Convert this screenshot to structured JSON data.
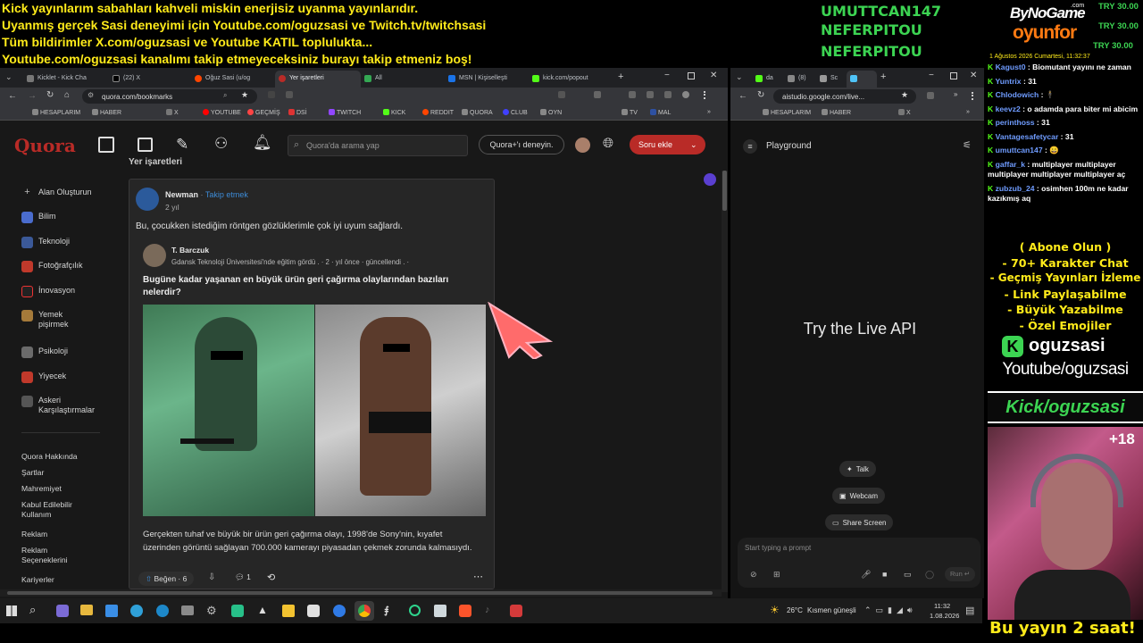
{
  "overlay": {
    "top_lines": [
      "Kick yayınlarım sabahları kahveli miskin enerjisiz uyanma yayınlarıdır.",
      "Uyanmış gerçek Sasi deneyimi için Youtube.com/oguzsasi ve Twitch.tv/twitchsasi",
      "Tüm bildirimler X.com/oguzsasi ve Youtube KATIL toplulukta...",
      "Youtube.com/oguzsasi kanalımı takip etmeyeceksiniz burayı takip etmeniz boş!"
    ],
    "subs": [
      "UMUTTCAN147",
      "NEFERPITOU",
      "NEFERPITOU"
    ],
    "logo_top": "ByNoGame",
    "logo_com": ".com",
    "logo_bottom": "oyunfor",
    "try": [
      "TRY 30.00",
      "TRY 30.00",
      "TRY 30.00"
    ],
    "chat_date": "1 Ağustos 2026 Cumartesi, 11:32:37",
    "chat": [
      {
        "user": "Kagust0",
        "msg": " : Biomutant yayını ne zaman"
      },
      {
        "user": "Yuntrix",
        "msg": " : 31"
      },
      {
        "user": "Chlodowich",
        "msg": " : 🕴"
      },
      {
        "user": "keevz2",
        "msg": " : o adamda para biter mi abicim"
      },
      {
        "user": "perinthoss",
        "msg": " : 31"
      },
      {
        "user": "Vantagesafetycar",
        "msg": " : 31"
      },
      {
        "user": "umuttcan147",
        "msg": " : 😀"
      },
      {
        "user": "gaffar_k",
        "msg": " : multiplayer multiplayer multiplayer multiplayer multiplayer aç"
      },
      {
        "user": "zubzub_24",
        "msg": " : osimhen 100m ne kadar kazıkmış aq"
      }
    ],
    "promo": [
      "( Abone Olun )",
      "- 70+ Karakter Chat",
      "- Geçmiş Yayınları İzleme",
      "- Link Paylaşabilme",
      "- Büyük Yazabilme",
      "- Özel Emojiler"
    ],
    "kick_name": "oguzsasi",
    "youtube_handle": "Youtube/oguzsasi",
    "kick_handle": "Kick/oguzsasi",
    "age": "+18",
    "bottom": "Bu yayın 2 saat!"
  },
  "left_browser": {
    "tabs": [
      "Kicklet - Kick Cha",
      "(22) X",
      "Oğuz Sasi (u/og",
      "Yer işaretleri",
      "All",
      "MSN | Kişiselleşti",
      "kick.com/popout"
    ],
    "url": "quora.com/bookmarks",
    "bookmarks": [
      "HESAPLARIM",
      "HABER",
      "X",
      "YOUTUBE",
      "GEÇMİŞ",
      "DSİ",
      "TWITCH",
      "KICK",
      "REDDIT",
      "QUORA",
      "CLUB",
      "OYN",
      "TV",
      "MAL"
    ]
  },
  "quora": {
    "logo": "Quora",
    "search_placeholder": "Quora'da arama yap",
    "plus_button": "Quora+'ı deneyin.",
    "ask_button": "Soru ekle",
    "section_title": "Yer işaretleri",
    "nav": [
      "Alan Oluşturun",
      "Bilim",
      "Teknoloji",
      "Fotoğrafçılık",
      "İnovasyon",
      "Yemek pişirmek",
      "Psikoloji",
      "Yiyecek",
      "Askeri Karşılaştırmalar"
    ],
    "footer": [
      "Quora Hakkında",
      "Şartlar",
      "Mahremiyet",
      "Kabul Edilebilir Kullanım",
      "Reklam",
      "Reklam Seçeneklerini",
      "Kariyerler"
    ],
    "post": {
      "author": "Newman",
      "follow": "Takip etmek",
      "time": "2 yıl",
      "text": "Bu, çocukken istediğim röntgen gözlüklerimle çok iyi uyum sağlardı.",
      "shared_author": "T. Barczuk",
      "shared_meta": "Gdansk Teknoloji Üniversitesi'nde eğitim gördü . · 2 · yıl önce · güncellendi . ·",
      "question": "Bugüne kadar yaşanan en büyük ürün geri çağırma olaylarından bazıları nelerdir?",
      "answer": "Gerçekten tuhaf ve büyük bir ürün geri çağırma olayı, 1998'de Sony'nin, kıyafet üzerinden görüntü sağlayan 700.000 kamerayı piyasadan çekmek zorunda kalmasıydı.",
      "upvote": "Beğen · 6",
      "comments": "1"
    }
  },
  "right_browser": {
    "tabs": [
      "da",
      "(8)",
      "Sc",
      ""
    ],
    "url": "aistudio.google.com/live...",
    "bookmarks": [
      "HESAPLARIM",
      "HABER",
      "X"
    ],
    "title": "Playground",
    "hero": "Try the Live API",
    "talk": "Talk",
    "webcam": "Webcam",
    "share": "Share Screen",
    "prompt_placeholder": "Start typing a prompt",
    "run": "Run"
  },
  "taskbar": {
    "weather": "26°C",
    "weather_desc": "Kısmen güneşli",
    "time": "11:32",
    "date": "1.08.2026"
  },
  "colors": {
    "overlay_yellow": "#ffeb1a",
    "sub_green": "#3cd452",
    "quora_red": "#b92b27",
    "kick_green": "#53fc18"
  }
}
